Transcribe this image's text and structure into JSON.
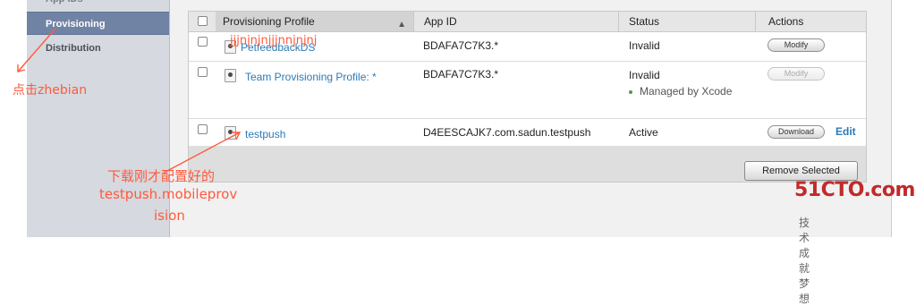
{
  "sidebar": {
    "items": [
      {
        "label": "App IDs",
        "active": false
      },
      {
        "label": "Provisioning",
        "active": true
      },
      {
        "label": "Distribution",
        "active": false
      }
    ]
  },
  "table": {
    "columns": [
      "Provisioning Profile",
      "App ID",
      "Status",
      "Actions"
    ],
    "sort_icon": "sort-ascending-icon",
    "rows": [
      {
        "profile": "PetfeedbackDS",
        "overlay_text": "jjjnjnjnjjjnnjnjnj",
        "app_id": "BDAFA7C7K3.*",
        "status": "Invalid",
        "status_note": "",
        "action": "Modify",
        "action_enabled": true,
        "edit": ""
      },
      {
        "profile": "Team Provisioning Profile: *",
        "overlay_text": "",
        "app_id": "BDAFA7C7K3.*",
        "status": "Invalid",
        "status_note": "Managed by Xcode",
        "action": "Modify",
        "action_enabled": false,
        "edit": ""
      },
      {
        "profile": "testpush",
        "overlay_text": "",
        "app_id": "D4EESCAJK7.com.sadun.testpush",
        "status": "Active",
        "status_note": "",
        "action": "Download",
        "action_enabled": true,
        "edit": "Edit"
      }
    ]
  },
  "footer": {
    "remove_label": "Remove Selected"
  },
  "annotations": {
    "left_note": "点击zhebian",
    "bottom_note_line1": "下载刚才配置好的",
    "bottom_note_line2": "testpush.mobileprov",
    "bottom_note_line3": "ision",
    "color": "#ff5a3c"
  },
  "watermark": {
    "main": "51CTO.com",
    "sub": "技术成就梦想"
  }
}
